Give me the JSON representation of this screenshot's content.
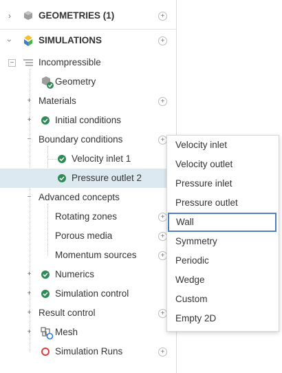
{
  "tree": {
    "geometries": {
      "label": "GEOMETRIES (1)"
    },
    "simulations": {
      "label": "SIMULATIONS"
    },
    "incompressible": {
      "label": "Incompressible"
    },
    "geometry": {
      "label": "Geometry"
    },
    "materials": {
      "label": "Materials"
    },
    "initial_conditions": {
      "label": "Initial conditions"
    },
    "boundary_conditions": {
      "label": "Boundary conditions"
    },
    "velocity_inlet_1": {
      "label": "Velocity inlet 1"
    },
    "pressure_outlet_2": {
      "label": "Pressure outlet 2"
    },
    "advanced_concepts": {
      "label": "Advanced concepts"
    },
    "rotating_zones": {
      "label": "Rotating zones"
    },
    "porous_media": {
      "label": "Porous media"
    },
    "momentum_sources": {
      "label": "Momentum sources"
    },
    "numerics": {
      "label": "Numerics"
    },
    "simulation_control": {
      "label": "Simulation control"
    },
    "result_control": {
      "label": "Result control"
    },
    "mesh": {
      "label": "Mesh"
    },
    "simulation_runs": {
      "label": "Simulation Runs"
    }
  },
  "menu": {
    "items": [
      "Velocity inlet",
      "Velocity outlet",
      "Pressure inlet",
      "Pressure outlet",
      "Wall",
      "Symmetry",
      "Periodic",
      "Wedge",
      "Custom",
      "Empty 2D"
    ],
    "highlighted": "Wall"
  },
  "colors": {
    "selection_bg": "#dde9f1",
    "check_green": "#2e8b57",
    "menu_highlight_border": "#4f7ec2",
    "error_red": "#e53935"
  }
}
